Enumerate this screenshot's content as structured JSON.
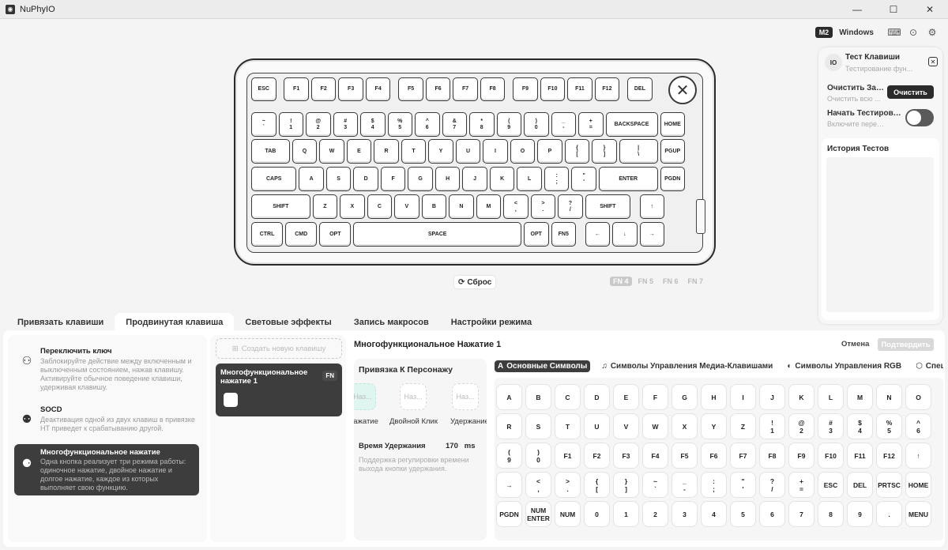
{
  "window": {
    "title": "NuPhyIO",
    "logo": "nuphy-logo",
    "controls": [
      "minimize",
      "maximize",
      "close"
    ]
  },
  "topbar": {
    "model_badge": "M2",
    "os_label": "Windows",
    "icons": [
      "keyboard-icon",
      "chat-icon",
      "settings-icon"
    ]
  },
  "keyboard": {
    "rows": [
      [
        {
          "l": "ESC"
        },
        {
          "l": "F1"
        },
        {
          "l": "F2"
        },
        {
          "l": "F3"
        },
        {
          "l": "F4"
        },
        {
          "l": "F5"
        },
        {
          "l": "F6"
        },
        {
          "l": "F7"
        },
        {
          "l": "F8"
        },
        {
          "l": "F9"
        },
        {
          "l": "F10"
        },
        {
          "l": "F11"
        },
        {
          "l": "F12"
        },
        {
          "l": "DEL"
        }
      ],
      [
        {
          "l": "~\n`"
        },
        {
          "l": "!\n1"
        },
        {
          "l": "@\n2"
        },
        {
          "l": "#\n3"
        },
        {
          "l": "$\n4"
        },
        {
          "l": "%\n5"
        },
        {
          "l": "^\n6"
        },
        {
          "l": "&\n7"
        },
        {
          "l": "*\n8"
        },
        {
          "l": "(\n9"
        },
        {
          "l": ")\n0"
        },
        {
          "l": "_\n-"
        },
        {
          "l": "+\n="
        },
        {
          "l": "BACKSPACE"
        },
        {
          "l": "HOME"
        }
      ],
      [
        {
          "l": "TAB"
        },
        {
          "l": "Q"
        },
        {
          "l": "W"
        },
        {
          "l": "E"
        },
        {
          "l": "R"
        },
        {
          "l": "T"
        },
        {
          "l": "Y"
        },
        {
          "l": "U"
        },
        {
          "l": "I"
        },
        {
          "l": "O"
        },
        {
          "l": "P"
        },
        {
          "l": "{\n["
        },
        {
          "l": "}\n]"
        },
        {
          "l": "|\n\\"
        },
        {
          "l": "PGUP"
        }
      ],
      [
        {
          "l": "CAPS"
        },
        {
          "l": "A"
        },
        {
          "l": "S"
        },
        {
          "l": "D"
        },
        {
          "l": "F"
        },
        {
          "l": "G"
        },
        {
          "l": "H"
        },
        {
          "l": "J"
        },
        {
          "l": "K"
        },
        {
          "l": "L"
        },
        {
          "l": ":\n;"
        },
        {
          "l": "\"\n'"
        },
        {
          "l": "ENTER"
        },
        {
          "l": "PGDN"
        }
      ],
      [
        {
          "l": "SHIFT"
        },
        {
          "l": "Z"
        },
        {
          "l": "X"
        },
        {
          "l": "C"
        },
        {
          "l": "V"
        },
        {
          "l": "B"
        },
        {
          "l": "N"
        },
        {
          "l": "M"
        },
        {
          "l": "<\n,"
        },
        {
          "l": ">\n."
        },
        {
          "l": "?\n/"
        },
        {
          "l": "SHIFT"
        },
        {
          "l": "↑"
        }
      ],
      [
        {
          "l": "CTRL"
        },
        {
          "l": "CMD"
        },
        {
          "l": "OPT"
        },
        {
          "l": "SPACE"
        },
        {
          "l": "OPT"
        },
        {
          "l": "FN5"
        },
        {
          "l": "←"
        },
        {
          "l": "↓"
        },
        {
          "l": "→"
        }
      ]
    ],
    "reset_label": "Сброс",
    "fn_layers": [
      "FN 4",
      "FN 5",
      "FN 6",
      "FN 7"
    ],
    "active_layer": "FN 4"
  },
  "test_panel": {
    "avatar": "IO",
    "title": "Тест Клавиши",
    "subtitle": "Тестирование фун...",
    "clear_label": "Очистить Зап...",
    "clear_sub": "Очистить всю ...",
    "clear_button": "Очистить",
    "start_label": "Начать Тестирование",
    "start_sub": "Включите переклю...",
    "start_toggle_on": false,
    "history_title": "История Тестов"
  },
  "tabs": [
    {
      "label": "Привязать клавиши",
      "active": false
    },
    {
      "label": "Продвинутая клавиша",
      "active": true
    },
    {
      "label": "Световые эффекты",
      "active": false
    },
    {
      "label": "Запись макросов",
      "active": false
    },
    {
      "label": "Настройки режима",
      "active": false
    }
  ],
  "modes": [
    {
      "title": "Переключить ключ",
      "desc": "Заблокируйте действие между включенным и выключенным состоянием, нажав клавишу. Активируйте обычное поведение клавиши, удерживая клавишу.",
      "icon": "toggle-tree-icon",
      "active": false
    },
    {
      "title": "SOCD",
      "desc": "Деактивация одной из двух клавиш в привязке HT приведет к срабатыванию другой.",
      "icon": "socd-icon",
      "active": false
    },
    {
      "title": "Многофункциональное нажатие",
      "desc": "Одна кнопка реализует три режима работы: одиночное нажатие, двойное нажатие и долгое нажатие, каждое из которых выполняет свою функцию.",
      "icon": "multi-tap-icon",
      "active": true
    }
  ],
  "middle": {
    "create_label": "Создать новую клавишу",
    "card_title": "Многофункциональное нажатие 1",
    "card_fn": "FN"
  },
  "editor": {
    "title": "Многофункциональное Нажатие 1",
    "cancel": "Отмена",
    "confirm": "Подтвердить",
    "bind_title": "Привязка К Персонажу",
    "slots": [
      {
        "placeholder": "Наз...",
        "label": "нажатие"
      },
      {
        "placeholder": "Наз...",
        "label": "Двойной Клик"
      },
      {
        "placeholder": "Наз...",
        "label": "Удержание"
      }
    ],
    "hold_label": "Время Удержания",
    "hold_value": "170",
    "hold_unit": "ms",
    "hold_desc": "Поддержка регулировки времени выхода кнопки удержания."
  },
  "symbols": {
    "tabs": [
      {
        "label": "Основные Символы",
        "icon": "A",
        "active": true
      },
      {
        "label": "Символы Управления Медиа-Клавишами",
        "icon": "♫",
        "active": false
      },
      {
        "label": "Символы Управления RGB",
        "icon": "◐",
        "active": false
      },
      {
        "label": "Специальны",
        "icon": "⬡",
        "active": false
      }
    ],
    "rows": [
      [
        "A",
        "B",
        "C",
        "D",
        "E",
        "F",
        "G",
        "H",
        "I",
        "J",
        "K",
        "L",
        "M",
        "N",
        "O"
      ],
      [
        "R",
        "S",
        "T",
        "U",
        "V",
        "W",
        "X",
        "Y",
        "Z",
        "!\n1",
        "@\n2",
        "#\n3",
        "$\n4",
        "%\n5",
        "^\n6"
      ],
      [
        "(\n9",
        ")\n0",
        "F1",
        "F2",
        "F3",
        "F4",
        "F5",
        "F6",
        "F7",
        "F8",
        "F9",
        "F10",
        "F11",
        "F12",
        "↑"
      ],
      [
        "→",
        "<\n,",
        ">\n.",
        "{\n[",
        "}\n]",
        "~\n`",
        "_\n-",
        ":\n;",
        "\"\n'",
        "?\n/",
        "+\n=",
        "ESC",
        "DEL",
        "PRTSC",
        "HOME"
      ],
      [
        "PGDN",
        "NUM\nENTER",
        "NUM",
        "0",
        "1",
        "2",
        "3",
        "4",
        "5",
        "6",
        "7",
        "8",
        "9",
        ".",
        "MENU"
      ]
    ]
  }
}
